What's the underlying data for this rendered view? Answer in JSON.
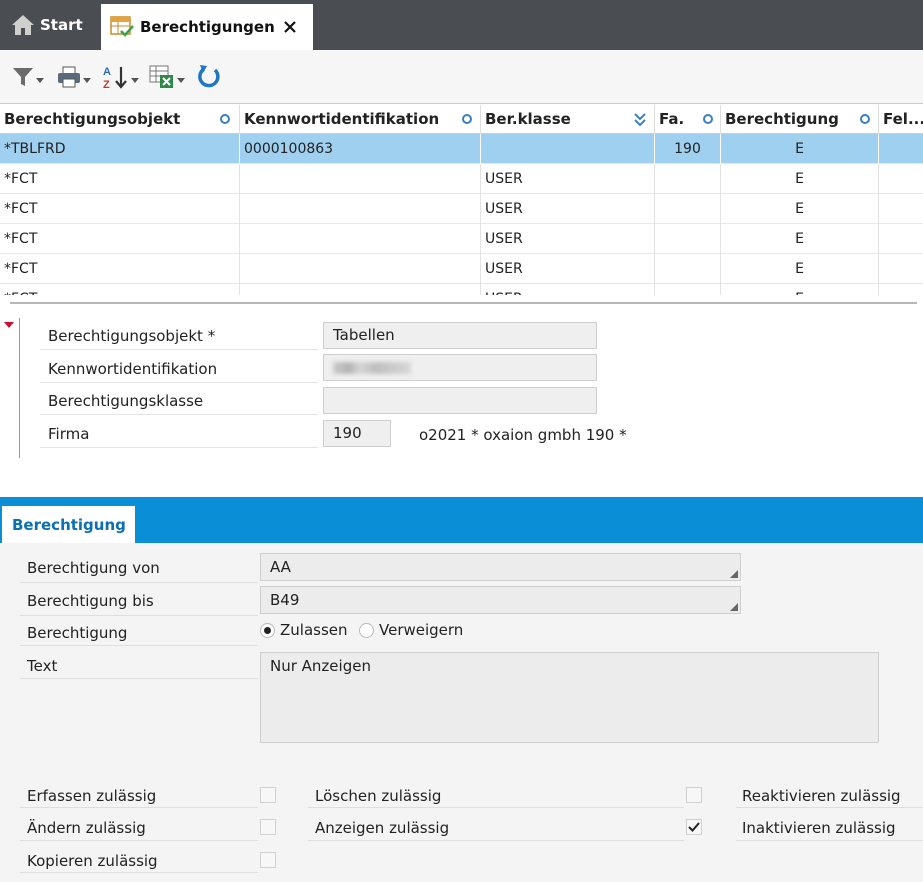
{
  "tabs": {
    "start_label": "Start",
    "active_label": "Berechtigungen"
  },
  "toolbar": {
    "icons": [
      "filter-icon",
      "print-icon",
      "sort-icon",
      "export-excel-icon",
      "refresh-icon"
    ]
  },
  "grid": {
    "columns": [
      "Berechtigungsobjekt",
      "Kennwortidentifikation",
      "Ber.klasse",
      "Fa.",
      "Berechtigung",
      "Fel..."
    ],
    "rows": [
      {
        "obj": "*TBLFRD",
        "kw": "0000100863",
        "bk": "",
        "fa": "190",
        "ber": "E",
        "selected": true
      },
      {
        "obj": "*FCT",
        "kw": "",
        "bk": "USER",
        "fa": "",
        "ber": "E",
        "selected": false
      },
      {
        "obj": "*FCT",
        "kw": "",
        "bk": "USER",
        "fa": "",
        "ber": "E",
        "selected": false
      },
      {
        "obj": "*FCT",
        "kw": "",
        "bk": "USER",
        "fa": "",
        "ber": "E",
        "selected": false
      },
      {
        "obj": "*FCT",
        "kw": "",
        "bk": "USER",
        "fa": "",
        "ber": "E",
        "selected": false
      },
      {
        "obj": "*FCT",
        "kw": "",
        "bk": "USER",
        "fa": "",
        "ber": "E",
        "selected": false
      }
    ]
  },
  "header_form": {
    "objekt_label": "Berechtigungsobjekt *",
    "objekt_value": "Tabellen",
    "kennwort_label": "Kennwortidentifikation",
    "klasse_label": "Berechtigungsklasse",
    "klasse_value": "",
    "firma_label": "Firma",
    "firma_value": "190",
    "firma_desc": "o2021 * oxaion gmbh  190 *"
  },
  "section": {
    "tab_label": "Berechtigung",
    "von_label": "Berechtigung von",
    "von_value": "AA",
    "bis_label": "Berechtigung bis",
    "bis_value": "B49",
    "ber_label": "Berechtigung",
    "radio_zulassen": "Zulassen",
    "radio_verweigern": "Verweigern",
    "radio_selected": "Zulassen",
    "text_label": "Text",
    "text_value": "Nur Anzeigen"
  },
  "permissions": {
    "erfassen": {
      "label": "Erfassen zulässig",
      "checked": false
    },
    "aendern": {
      "label": "Ändern zulässig",
      "checked": false
    },
    "kopieren": {
      "label": "Kopieren zulässig",
      "checked": false
    },
    "loeschen": {
      "label": "Löschen zulässig",
      "checked": false
    },
    "anzeigen": {
      "label": "Anzeigen zulässig",
      "checked": true
    },
    "reaktivieren": {
      "label": "Reaktivieren zulässig"
    },
    "inaktivieren": {
      "label": "Inaktivieren zulässig"
    }
  },
  "colors": {
    "tabbar": "#4a4d52",
    "selected_row": "#9fd0ef",
    "section_blue": "#0a8fd6",
    "required_marker": "#c8102e"
  }
}
